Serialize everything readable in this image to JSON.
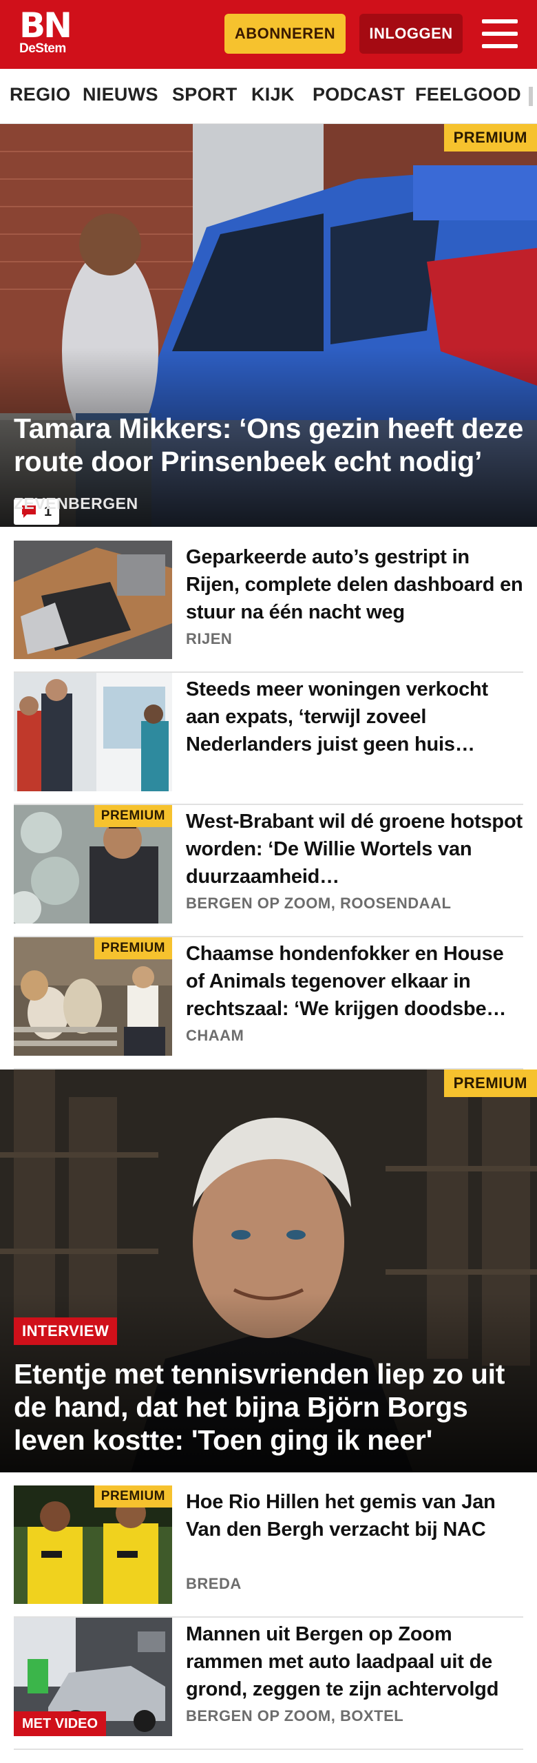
{
  "brand": {
    "logo_main": "BN",
    "logo_sub": "DeStem",
    "accent": "#d0101a",
    "premium_color": "#f6c22e"
  },
  "header": {
    "subscribe_label": "ABONNEREN",
    "login_label": "INLOGGEN",
    "menu_icon": "hamburger-icon"
  },
  "nav": {
    "items": [
      {
        "label": "REGIO"
      },
      {
        "label": "NIEUWS"
      },
      {
        "label": "SPORT"
      },
      {
        "label": "KIJK"
      },
      {
        "label": "PODCAST"
      },
      {
        "label": "FEELGOOD"
      }
    ]
  },
  "hero1": {
    "badge": "PREMIUM",
    "comments": "1",
    "title": "Tamara Mikkers: ‘Ons gezin heeft deze route door Prinsenbeek echt nodig’",
    "location": "ZEVENBERGEN"
  },
  "list1": [
    {
      "title": "Geparkeerde auto’s gestript in Rijen, complete delen dashboard en stuur na één nacht weg",
      "location": "RIJEN",
      "premium": ""
    },
    {
      "title": "Steeds meer woningen verkocht aan expats, ‘terwijl zoveel Nederlanders juist geen huis…",
      "location": "",
      "premium": ""
    },
    {
      "title": "West-Brabant wil dé groene hotspot worden: ‘De Willie Wortels van duurzaamheid…",
      "location": "BERGEN OP ZOOM, ROOSENDAAL",
      "premium": "PREMIUM"
    },
    {
      "title": "Chaamse hondenfokker en House of Animals tegenover elkaar in rechtszaal: ‘We krijgen doodsbe…",
      "location": "CHAAM",
      "premium": "PREMIUM"
    }
  ],
  "hero2": {
    "badge": "PREMIUM",
    "tag": "INTERVIEW",
    "title": "Etentje met tennisvrienden liep zo uit de hand, dat het bijna Björn Borgs leven kostte: 'Toen ging ik neer'"
  },
  "list2": [
    {
      "title": "Hoe Rio Hillen het gemis van Jan Van den Bergh verzacht bij NAC",
      "location": "BREDA",
      "premium": "PREMIUM",
      "video": ""
    },
    {
      "title": "Mannen uit Bergen op Zoom rammen met auto laadpaal uit de grond, zeggen te zijn achtervolgd",
      "location": "BERGEN OP ZOOM, BOXTEL",
      "premium": "",
      "video": "MET VIDEO"
    }
  ]
}
